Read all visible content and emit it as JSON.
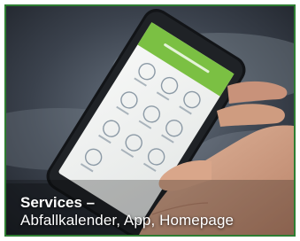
{
  "caption": {
    "title": "Services –",
    "subtitle": "Abfallkalender, App, Homepage"
  },
  "colors": {
    "frame_border": "#2e7d32",
    "app_header": "#7bc043",
    "icon_stroke": "#8c9aa6"
  },
  "phone_screen": {
    "header_icon": "app-header",
    "icons": [
      "calendar-icon",
      "bulk-waste-icon",
      "location-icon",
      "clock-icon",
      "info-icon",
      "recycle-icon",
      "leaf-icon",
      "bin-icon",
      "settings-icon",
      "truck-icon"
    ]
  }
}
